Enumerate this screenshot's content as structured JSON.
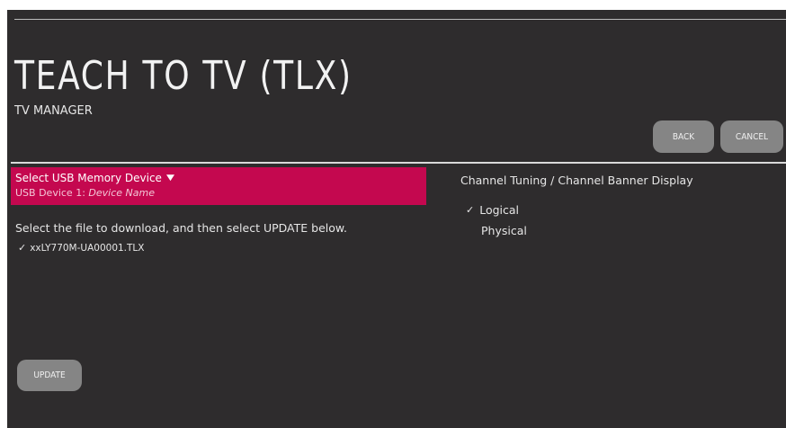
{
  "page": {
    "title": "TEACH TO TV (TLX)",
    "subtitle": "TV MANAGER"
  },
  "buttons": {
    "back": "BACK",
    "cancel": "CANCEL",
    "update": "UPDATE"
  },
  "usb": {
    "select_label": "Select USB Memory Device",
    "device_prefix": "USB Device 1: ",
    "device_name": "Device Name",
    "chevron_icon": "chevron-down-icon",
    "accent_color": "#c4084f"
  },
  "files": {
    "instruction": "Select the file to download, and then select UPDATE below.",
    "items": [
      {
        "name": "xxLY770M-UA00001.TLX",
        "selected": true
      }
    ]
  },
  "tuning": {
    "title": "Channel Tuning / Channel Banner Display",
    "options": [
      {
        "label": "Logical",
        "selected": true
      },
      {
        "label": "Physical",
        "selected": false
      }
    ]
  },
  "icons": {
    "check": "check-icon",
    "check_glyph": "✓"
  },
  "colors": {
    "background": "#2e2c2d",
    "button": "#858585"
  }
}
